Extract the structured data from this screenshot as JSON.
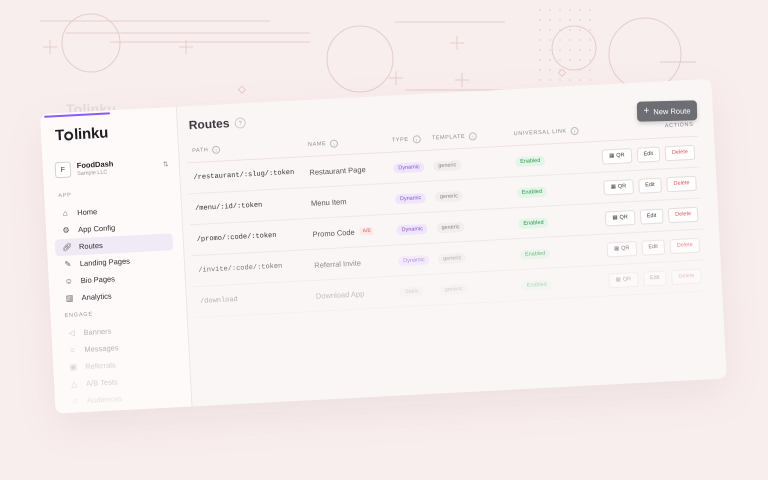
{
  "app": {
    "brand": "Tolinku",
    "ghost_brand": "Tolinku"
  },
  "top_action": {
    "label": "New Route"
  },
  "workspace": {
    "initial": "F",
    "name": "FoodDash",
    "org": "Sample LLC"
  },
  "sidebar": {
    "section_app": "APP",
    "section_engage": "ENGAGE",
    "items": [
      {
        "label": "Home",
        "icon": "home-icon"
      },
      {
        "label": "App Config",
        "icon": "gear-icon"
      },
      {
        "label": "Routes",
        "icon": "link-icon"
      },
      {
        "label": "Landing Pages",
        "icon": "brush-icon"
      },
      {
        "label": "Bio Pages",
        "icon": "user-icon"
      },
      {
        "label": "Analytics",
        "icon": "bar-chart-icon"
      }
    ],
    "engage_items": [
      {
        "label": "Banners",
        "icon": "megaphone-icon"
      },
      {
        "label": "Messages",
        "icon": "message-icon"
      },
      {
        "label": "Referrals",
        "icon": "gift-icon"
      },
      {
        "label": "A/B Tests",
        "icon": "flask-icon"
      },
      {
        "label": "Audiences",
        "icon": "users-icon"
      }
    ]
  },
  "page": {
    "title": "Routes",
    "help": "?"
  },
  "table": {
    "headers": {
      "path": "PATH",
      "name": "NAME",
      "type": "TYPE",
      "template": "TEMPLATE",
      "universal_link": "UNIVERSAL LINK",
      "actions": "ACTIONS"
    },
    "rows": [
      {
        "path": "/restaurant/:slug/:token",
        "name": "Restaurant Page",
        "type": "Dynamic",
        "template": "generic",
        "universal_link": "Enabled"
      },
      {
        "path": "/menu/:id/:token",
        "name": "Menu Item",
        "type": "Dynamic",
        "template": "generic",
        "universal_link": "Enabled"
      },
      {
        "path": "/promo/:code/:token",
        "name": "Promo Code",
        "badge": "A/B",
        "type": "Dynamic",
        "template": "generic",
        "universal_link": "Enabled"
      },
      {
        "path": "/invite/:code/:token",
        "name": "Referral Invite",
        "type": "Dynamic",
        "template": "generic",
        "universal_link": "Enabled"
      },
      {
        "path": "/download",
        "name": "Download App",
        "type": "Static",
        "template": "generic",
        "universal_link": "Enabled"
      }
    ],
    "action_labels": {
      "qr": "QR",
      "edit": "Edit",
      "delete": "Delete"
    }
  },
  "colors": {
    "accent": "#8b5cf6",
    "danger": "#e05454",
    "success": "#2f9a52",
    "background": "#f9eeee"
  }
}
